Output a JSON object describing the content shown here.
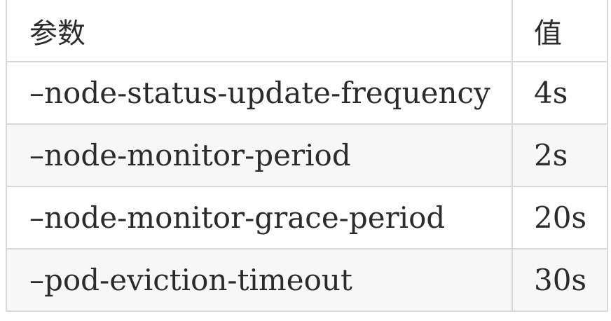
{
  "table": {
    "headers": {
      "param": "参数",
      "value": "值"
    },
    "rows": [
      {
        "param": "–node-status-update-frequency",
        "value": "4s"
      },
      {
        "param": "–node-monitor-period",
        "value": "2s"
      },
      {
        "param": "–node-monitor-grace-period",
        "value": "20s"
      },
      {
        "param": "–pod-eviction-timeout",
        "value": "30s"
      }
    ]
  }
}
